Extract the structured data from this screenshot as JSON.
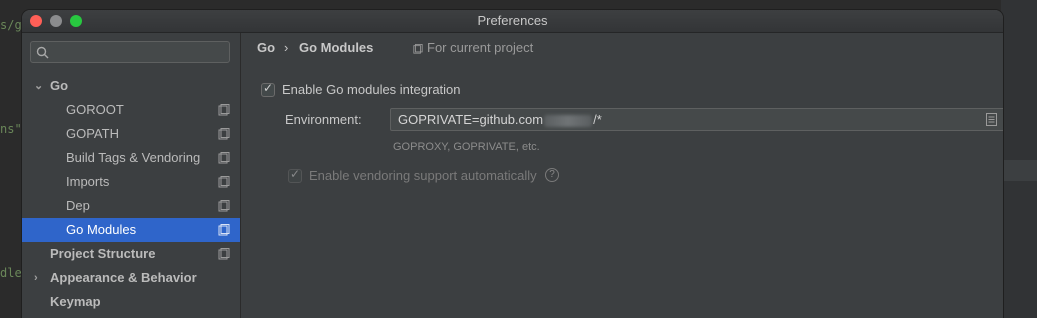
{
  "background": {
    "code_lines": [
      {
        "text": "s/g"
      },
      {
        "text": "ns\""
      },
      {
        "text": "dle"
      }
    ]
  },
  "window": {
    "title": "Preferences"
  },
  "sidebar": {
    "search_placeholder": "",
    "items": [
      {
        "label": "Go",
        "expanded": true,
        "bold": true
      },
      {
        "label": "GOROOT"
      },
      {
        "label": "GOPATH"
      },
      {
        "label": "Build Tags & Vendoring"
      },
      {
        "label": "Imports"
      },
      {
        "label": "Dep"
      },
      {
        "label": "Go Modules",
        "selected": true
      },
      {
        "label": "Project Structure",
        "bold": true
      },
      {
        "label": "Appearance & Behavior",
        "bold": true,
        "expandable": true
      },
      {
        "label": "Keymap",
        "bold": true
      }
    ]
  },
  "content": {
    "breadcrumb": [
      "Go",
      "Go Modules"
    ],
    "breadcrumb_separator": "›",
    "scope_label": "For current project",
    "enable_modules": {
      "label": "Enable Go modules integration",
      "checked": true
    },
    "environment": {
      "label": "Environment:",
      "value_prefix": "GOPRIVATE=github.com",
      "value_suffix": "/*",
      "hint": "GOPROXY, GOPRIVATE, etc."
    },
    "enable_vendoring": {
      "label": "Enable vendoring support automatically",
      "checked": true,
      "disabled": true
    }
  },
  "colors": {
    "selection": "#2f65ca",
    "window_bg": "#3c3f41",
    "close": "#ff5f57",
    "maximize": "#28c840"
  }
}
